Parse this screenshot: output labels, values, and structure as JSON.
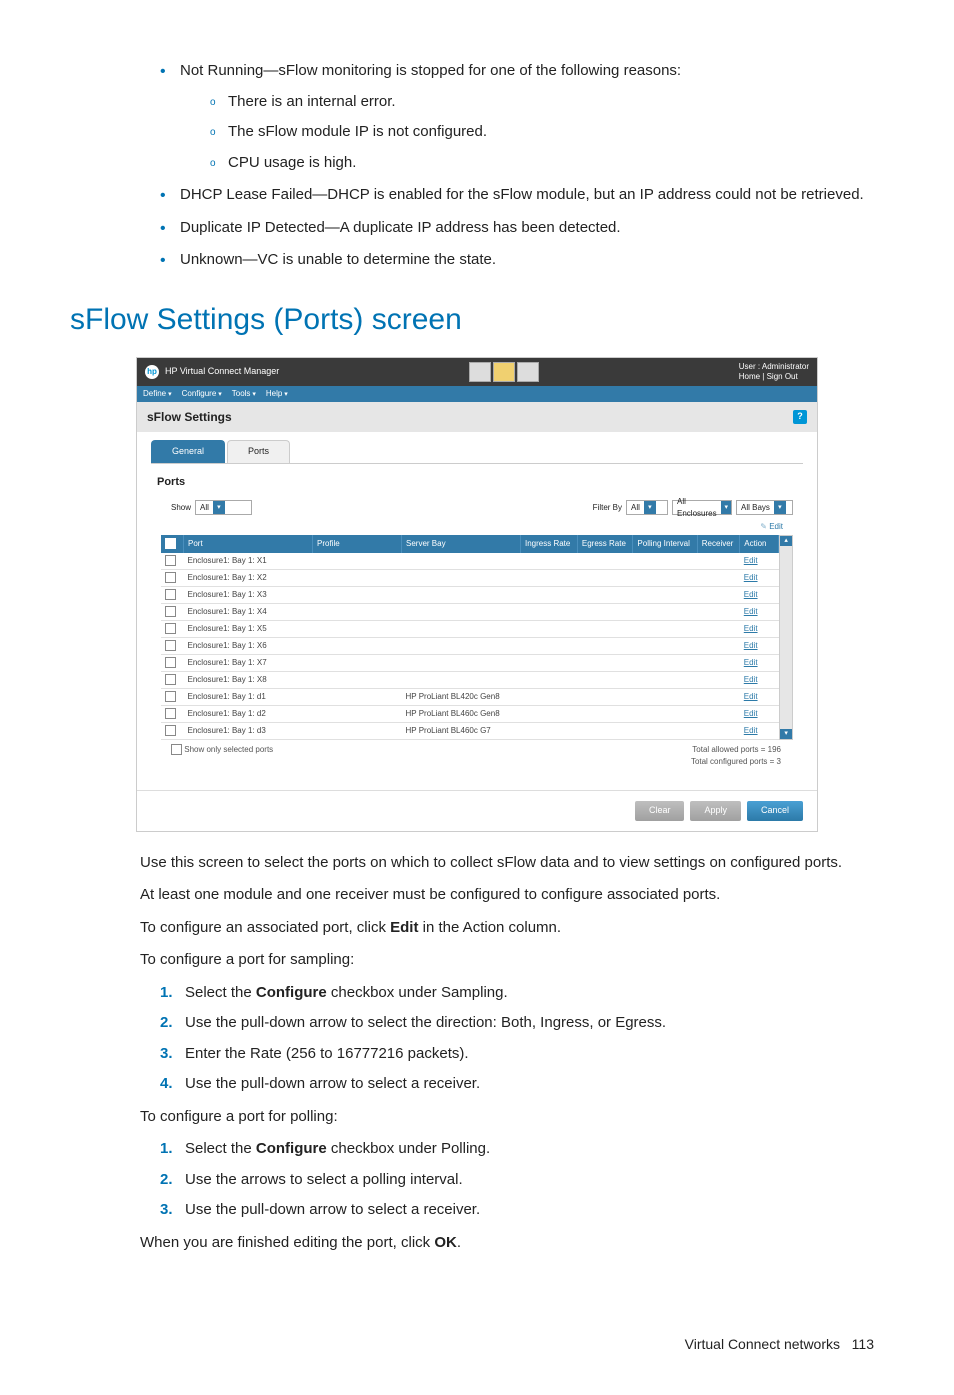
{
  "bullets": {
    "notRunning": "Not Running—sFlow monitoring is stopped for one of the following reasons:",
    "sub": [
      "There is an internal error.",
      "The sFlow module IP is not configured.",
      "CPU usage is high."
    ],
    "dhcp": "DHCP Lease Failed—DHCP is enabled for the sFlow module, but an IP address could not be retrieved.",
    "dup": "Duplicate IP Detected—A duplicate IP address has been detected.",
    "unknown": "Unknown—VC is unable to determine the state."
  },
  "heading": "sFlow Settings (Ports) screen",
  "screenshot": {
    "appTitle": "HP Virtual Connect Manager",
    "user": {
      "line1": "User : Administrator",
      "line2": "Home  |  Sign Out"
    },
    "menus": [
      "Define",
      "Configure",
      "Tools",
      "Help"
    ],
    "pageTitle": "sFlow Settings",
    "tabs": {
      "general": "General",
      "ports": "Ports"
    },
    "subhead": "Ports",
    "showLabel": "Show",
    "showValue": "All",
    "filterByLabel": "Filter By",
    "filterByValue": "All",
    "encValue": "All Enclosures",
    "baysValue": "All Bays",
    "editLink": "Edit",
    "columns": [
      "",
      "Port",
      "Profile",
      "Server Bay",
      "Ingress Rate",
      "Egress Rate",
      "Polling Interval",
      "Receiver",
      "Action"
    ],
    "rows": [
      {
        "port": "Enclosure1: Bay 1: X1",
        "server": "",
        "action": "Edit"
      },
      {
        "port": "Enclosure1: Bay 1: X2",
        "server": "",
        "action": "Edit"
      },
      {
        "port": "Enclosure1: Bay 1: X3",
        "server": "",
        "action": "Edit"
      },
      {
        "port": "Enclosure1: Bay 1: X4",
        "server": "",
        "action": "Edit"
      },
      {
        "port": "Enclosure1: Bay 1: X5",
        "server": "",
        "action": "Edit"
      },
      {
        "port": "Enclosure1: Bay 1: X6",
        "server": "",
        "action": "Edit"
      },
      {
        "port": "Enclosure1: Bay 1: X7",
        "server": "",
        "action": "Edit"
      },
      {
        "port": "Enclosure1: Bay 1: X8",
        "server": "",
        "action": "Edit"
      },
      {
        "port": "Enclosure1: Bay 1: d1",
        "server": "HP ProLiant BL420c Gen8",
        "action": "Edit"
      },
      {
        "port": "Enclosure1: Bay 1: d2",
        "server": "HP ProLiant BL460c Gen8",
        "action": "Edit"
      },
      {
        "port": "Enclosure1: Bay 1: d3",
        "server": "HP ProLiant BL460c G7",
        "action": "Edit"
      }
    ],
    "showOnly": "Show only selected ports",
    "totals1": "Total allowed ports = 196",
    "totals2": "Total configured ports = 3",
    "buttons": {
      "clear": "Clear",
      "apply": "Apply",
      "cancel": "Cancel"
    }
  },
  "paras": {
    "p1": "Use this screen to select the ports on which to collect sFlow data and to view settings on configured ports.",
    "p2": "At least one module and one receiver must be configured to configure associated ports.",
    "p3a": "To configure an associated port, click ",
    "p3b": "Edit",
    "p3c": " in the Action column.",
    "p4": "To configure a port for sampling:",
    "p5": "To configure a port for polling:",
    "p6a": "When you are finished editing the port, click ",
    "p6b": "OK",
    "p6c": "."
  },
  "sampling": [
    {
      "pre": "Select the ",
      "bold": "Configure",
      "post": " checkbox under Sampling."
    },
    {
      "pre": "Use the pull-down arrow to select the direction: Both, Ingress, or Egress.",
      "bold": "",
      "post": ""
    },
    {
      "pre": "Enter the Rate (256 to 16777216 packets).",
      "bold": "",
      "post": ""
    },
    {
      "pre": "Use the pull-down arrow to select a receiver.",
      "bold": "",
      "post": ""
    }
  ],
  "polling": [
    {
      "pre": "Select the ",
      "bold": "Configure",
      "post": " checkbox under Polling."
    },
    {
      "pre": "Use the arrows to select a polling interval.",
      "bold": "",
      "post": ""
    },
    {
      "pre": "Use the pull-down arrow to select a receiver.",
      "bold": "",
      "post": ""
    }
  ],
  "footer": {
    "section": "Virtual Connect networks",
    "page": "113"
  }
}
